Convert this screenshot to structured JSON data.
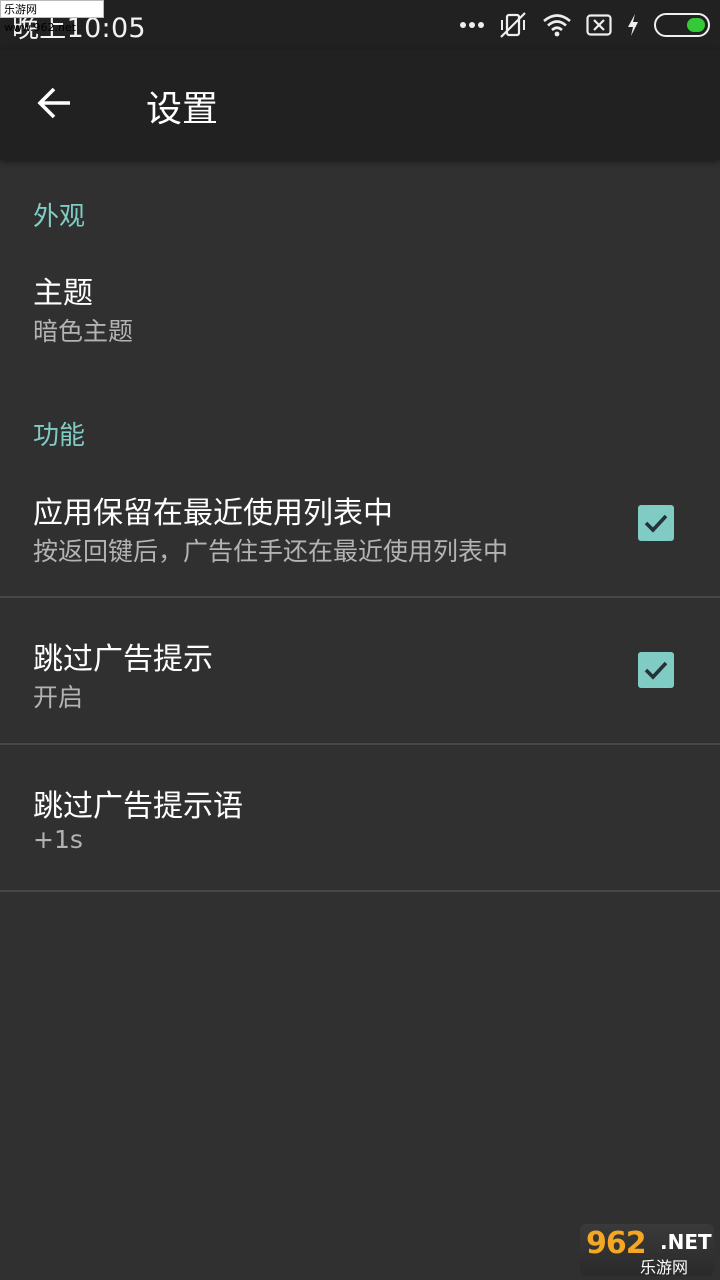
{
  "status_bar": {
    "time": "晚上10:05",
    "watermark": "乐游网 www.962.net",
    "icons": [
      "more-dots-icon",
      "vibrate-off-icon",
      "wifi-icon",
      "sim-x-icon",
      "charging-bolt-icon",
      "battery-icon"
    ]
  },
  "toolbar": {
    "title": "设置"
  },
  "sections": [
    {
      "category": "外观",
      "items": [
        {
          "title": "主题",
          "summary": "暗色主题"
        }
      ]
    },
    {
      "category": "功能",
      "items": [
        {
          "title": "应用保留在最近使用列表中",
          "summary": "按返回键后，广告住手还在最近使用列表中",
          "checked": true
        },
        {
          "title": "跳过广告提示",
          "summary": "开启",
          "checked": true
        },
        {
          "title": "跳过广告提示语",
          "summary": "+1s"
        }
      ]
    }
  ],
  "watermark_bottom": {
    "logo": "962",
    "net": ".NET",
    "text": "乐游网"
  },
  "colors": {
    "accent": "#80cbc4",
    "background": "#303030",
    "toolbar": "#212121",
    "battery": "#35c93a"
  }
}
